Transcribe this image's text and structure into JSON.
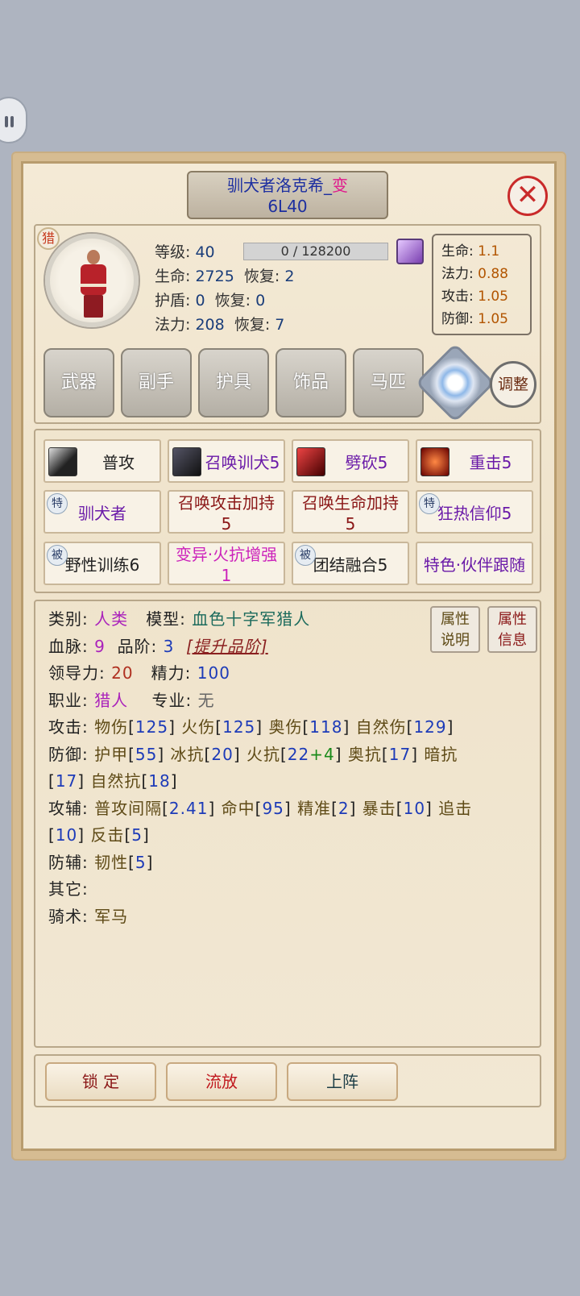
{
  "header": {
    "name": "驯犬者洛克希_",
    "name_suffix": "变",
    "code": "6L40"
  },
  "badge": {
    "class": "猎"
  },
  "stats": {
    "level_label": "等级:",
    "level": "40",
    "exp": "0 / 128200",
    "hp_label": "生命:",
    "hp": "2725",
    "hp_regen_label": "恢复:",
    "hp_regen": "2",
    "shield_label": "护盾:",
    "shield": "0",
    "shield_regen_label": "恢复:",
    "shield_regen": "0",
    "mana_label": "法力:",
    "mana": "208",
    "mana_regen_label": "恢复:",
    "mana_regen": "7"
  },
  "ratios": [
    {
      "label": "生命:",
      "value": "1.1"
    },
    {
      "label": "法力:",
      "value": "0.88"
    },
    {
      "label": "攻击:",
      "value": "1.05"
    },
    {
      "label": "防御:",
      "value": "1.05"
    }
  ],
  "equipment": [
    "武器",
    "副手",
    "护具",
    "饰品",
    "马匹"
  ],
  "adjust_label": "调整",
  "skills": {
    "row1": [
      "普攻",
      "召唤训犬5",
      "劈砍5",
      "重击5"
    ],
    "row2": {
      "tag": "特",
      "s1": "驯犬者",
      "s2a": "召唤攻击加持",
      "s2b": "5",
      "s3a": "召唤生命加持",
      "s3b": "5",
      "s4": "狂热信仰5"
    },
    "row3": {
      "tag": "被",
      "s1": "野性训练6",
      "s2a": "变异·火抗增强",
      "s2b": "1",
      "s3": "团结融合5",
      "s4": "特色·伙伴跟随"
    }
  },
  "detail": {
    "type_label": "类别:",
    "type": "人类",
    "model_label": "模型:",
    "model": "血色十字军猎人",
    "blood_label": "血脉:",
    "blood": "9",
    "grade_label": "品阶:",
    "grade": "3",
    "upgrade": "[提升品阶]",
    "lead_label": "领导力:",
    "lead": "20",
    "energy_label": "精力:",
    "energy": "100",
    "job_label": "职业:",
    "job": "猎人",
    "spec_label": "专业:",
    "spec": "无",
    "atk_label": "攻击:",
    "atk": [
      {
        "k": "物伤",
        "v": "125"
      },
      {
        "k": "火伤",
        "v": "125"
      },
      {
        "k": "奥伤",
        "v": "118"
      },
      {
        "k": "自然伤",
        "v": "129"
      }
    ],
    "def_label": "防御:",
    "def_line1": [
      {
        "k": "护甲",
        "v": "55"
      },
      {
        "k": "冰抗",
        "v": "20"
      }
    ],
    "fire_k": "火抗",
    "fire_v": "22",
    "fire_plus": "+",
    "fire_bonus": "4",
    "arcane_k": "奥抗",
    "arcane_v": "17",
    "dark_k": "暗抗",
    "dark_v": "17",
    "nature_k": "自然抗",
    "nature_v": "18",
    "atkaux_label": "攻辅:",
    "atkaux_line1": [
      {
        "k": "普攻间隔",
        "v": "2.41"
      },
      {
        "k": "命中",
        "v": "95"
      },
      {
        "k": "精准",
        "v": "2"
      },
      {
        "k": "暴击",
        "v": "10"
      }
    ],
    "chase_k": "追击",
    "chase_v": "10",
    "counter_k": "反击",
    "counter_v": "5",
    "defaux_label": "防辅:",
    "tough_k": "韧性",
    "tough_v": "5",
    "other_label": "其它:",
    "ride_label": "骑术:",
    "ride": "军马"
  },
  "attr_buttons": [
    {
      "l1": "属性",
      "l2": "说明"
    },
    {
      "l1": "属性",
      "l2": "信息"
    }
  ],
  "bottom": {
    "lock": "锁 定",
    "exile": "流放",
    "deploy": "上阵"
  },
  "colors": {
    "panel": "#f2e8d4",
    "frame": "#d6bc92",
    "accent_red": "#c92a2a"
  }
}
